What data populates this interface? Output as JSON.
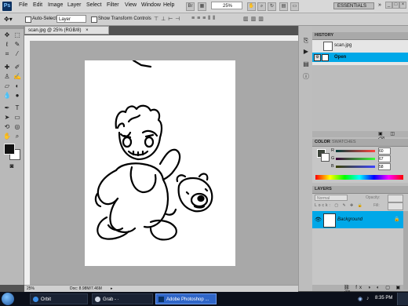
{
  "menubar": {
    "logo": "Ps",
    "items": [
      "File",
      "Edit",
      "Image",
      "Layer",
      "Select",
      "Filter",
      "View",
      "Window",
      "Help"
    ],
    "zoom": "25%",
    "workspace": "ESSENTIALS"
  },
  "options": {
    "auto_select_label": "Auto-Select:",
    "auto_select_value": "Layer",
    "show_transform_label": "Show Transform Controls"
  },
  "document": {
    "tab_title": "scan.jpg @ 25% (RGB/8)",
    "status_zoom": "25%",
    "status_doc": "Doc: 8.98M/7.46M"
  },
  "history": {
    "title": "HISTORY",
    "snapshot": "scan.jpg",
    "item": "Open"
  },
  "color": {
    "tab_color": "COLOR",
    "tab_swatches": "SWATCHES",
    "r_label": "R",
    "r_value": "60",
    "g_label": "G",
    "g_value": "67",
    "b_label": "B",
    "b_value": "58",
    "fg_color": "#3c433a"
  },
  "layers": {
    "title": "LAYERS",
    "blend_mode": "Normal",
    "opacity_label": "Opacity:",
    "fill_label": "Fill:",
    "layer_name": "Background"
  },
  "taskbar": {
    "items": [
      "Orbit",
      "Grab - ·",
      "Adobe Photoshop ..."
    ],
    "time": "8:35 PM"
  },
  "colors": {
    "accent_blue": "#00a8e8",
    "menubar": "#d8d8d8"
  }
}
